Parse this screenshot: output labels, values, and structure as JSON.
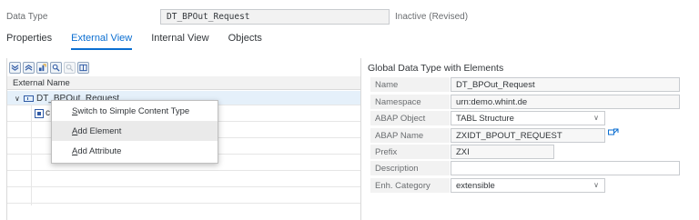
{
  "header": {
    "data_type_label": "Data Type",
    "data_type_value": "DT_BPOut_Request",
    "status": "Inactive (Revised)"
  },
  "tabs": [
    {
      "label": "Properties",
      "selected": false
    },
    {
      "label": "External View",
      "selected": true
    },
    {
      "label": "Internal View",
      "selected": false
    },
    {
      "label": "Objects",
      "selected": false
    }
  ],
  "toolbar": {
    "icons": [
      "expand-all-icon",
      "collapse-all-icon",
      "node-settings-icon",
      "search-icon",
      "search-next-icon",
      "columns-icon"
    ]
  },
  "tree": {
    "column_header": "External Name",
    "root_node": "DT_BPOut_Request",
    "child_node": "c"
  },
  "context_menu": {
    "items": [
      {
        "label": "Switch to Simple Content Type",
        "hotkey": "S",
        "rest": "witch to Simple Content Type"
      },
      {
        "label": "Add Element",
        "hotkey": "A",
        "rest": "dd Element"
      },
      {
        "label": "Add Attribute",
        "hotkey": "A",
        "rest": "dd Attribute"
      }
    ]
  },
  "right_panel": {
    "title": "Global Data Type with Elements",
    "fields": [
      {
        "label": "Name",
        "value": "DT_BPOut_Request"
      },
      {
        "label": "Namespace",
        "value": "urn:demo.whint.de"
      },
      {
        "label": "ABAP Object",
        "value": "TABL Structure"
      },
      {
        "label": "ABAP Name",
        "value": "ZXIDT_BPOUT_REQUEST"
      },
      {
        "label": "Prefix",
        "value": "ZXI"
      },
      {
        "label": "Description",
        "value": ""
      },
      {
        "label": "Enh. Category",
        "value": "extensible"
      }
    ]
  },
  "colors": {
    "accent": "#0a6ed1",
    "selected_row": "#e5f0fa",
    "label_bg": "#f2f2f2"
  }
}
